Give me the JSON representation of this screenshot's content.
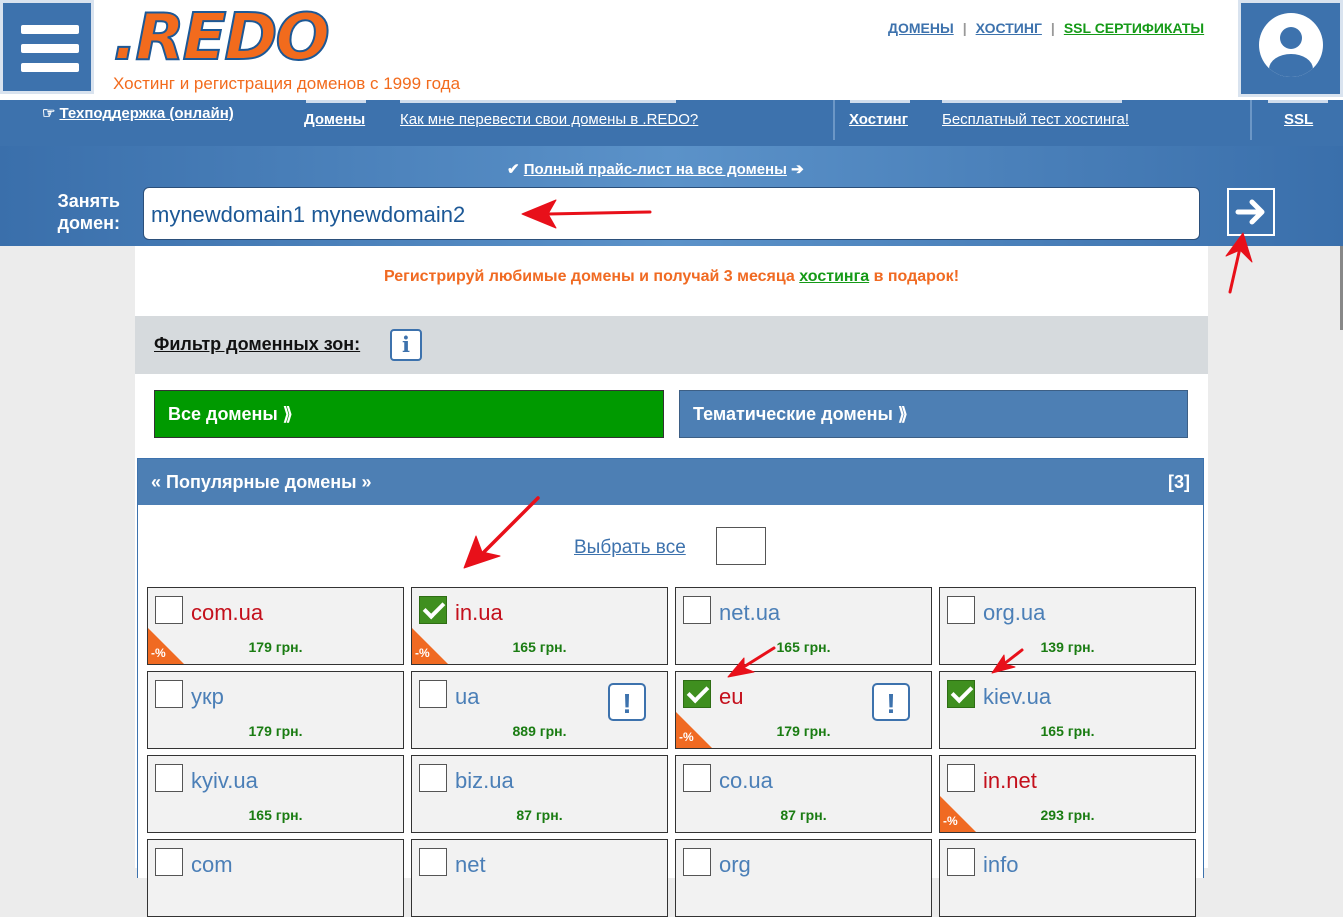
{
  "header": {
    "logo": ".REDO",
    "tagline": "Хостинг и регистрация доменов с 1999 года",
    "links": [
      "ДОМЕНЫ",
      "ХОСТИНГ",
      "SSL СЕРТИФИКАТЫ"
    ]
  },
  "nav": {
    "support": "Техподдержка (онлайн)",
    "domains": "Домены",
    "transfer": "Как мне перевести свои домены в .REDO?",
    "hosting": "Хостинг",
    "hosting_test": "Бесплатный тест хостинга!",
    "ssl": "SSL"
  },
  "search": {
    "pricelist": "Полный прайс-лист на все домены",
    "label": "Занять домен:",
    "value": "mynewdomain1 mynewdomain2"
  },
  "promo": {
    "before": "Регистрируй любимые домены и получай 3 месяца ",
    "link": "хостинга",
    "after": " в подарок!"
  },
  "filter": {
    "label": "Фильтр доменных зон:",
    "info_icon": "i",
    "all_domains": "Все домены ⟫",
    "thematic_domains": "Тематические домены ⟫"
  },
  "popular": {
    "title": "« Популярные домены »",
    "count": "[3]",
    "select_all": "Выбрать все"
  },
  "domains": [
    {
      "name": "com.ua",
      "price": "179 грн.",
      "checked": false,
      "red": true,
      "discount": true,
      "warn": false
    },
    {
      "name": "in.ua",
      "price": "165 грн.",
      "checked": true,
      "red": true,
      "discount": true,
      "warn": false
    },
    {
      "name": "net.ua",
      "price": "165 грн.",
      "checked": false,
      "red": false,
      "discount": false,
      "warn": false
    },
    {
      "name": "org.ua",
      "price": "139 грн.",
      "checked": false,
      "red": false,
      "discount": false,
      "warn": false
    },
    {
      "name": "укр",
      "price": "179 грн.",
      "checked": false,
      "red": false,
      "discount": false,
      "warn": false
    },
    {
      "name": "ua",
      "price": "889 грн.",
      "checked": false,
      "red": false,
      "discount": false,
      "warn": true
    },
    {
      "name": "eu",
      "price": "179 грн.",
      "checked": true,
      "red": true,
      "discount": true,
      "warn": true
    },
    {
      "name": "kiev.ua",
      "price": "165 грн.",
      "checked": true,
      "red": false,
      "discount": false,
      "warn": false
    },
    {
      "name": "kyiv.ua",
      "price": "165 грн.",
      "checked": false,
      "red": false,
      "discount": false,
      "warn": false
    },
    {
      "name": "biz.ua",
      "price": "87 грн.",
      "checked": false,
      "red": false,
      "discount": false,
      "warn": false
    },
    {
      "name": "co.ua",
      "price": "87 грн.",
      "checked": false,
      "red": false,
      "discount": false,
      "warn": false
    },
    {
      "name": "in.net",
      "price": "293 грн.",
      "checked": false,
      "red": true,
      "discount": true,
      "warn": false
    },
    {
      "name": "com",
      "price": "",
      "checked": false,
      "red": false,
      "discount": false,
      "warn": false
    },
    {
      "name": "net",
      "price": "",
      "checked": false,
      "red": false,
      "discount": false,
      "warn": false
    },
    {
      "name": "org",
      "price": "",
      "checked": false,
      "red": false,
      "discount": false,
      "warn": false
    },
    {
      "name": "info",
      "price": "",
      "checked": false,
      "red": false,
      "discount": false,
      "warn": false
    }
  ],
  "discount_label": "-%",
  "warn_label": "!",
  "colors": {
    "brand": "#3d72ad",
    "accent": "#f26b1d",
    "green": "#009a00",
    "annotation": "#e8101a"
  }
}
